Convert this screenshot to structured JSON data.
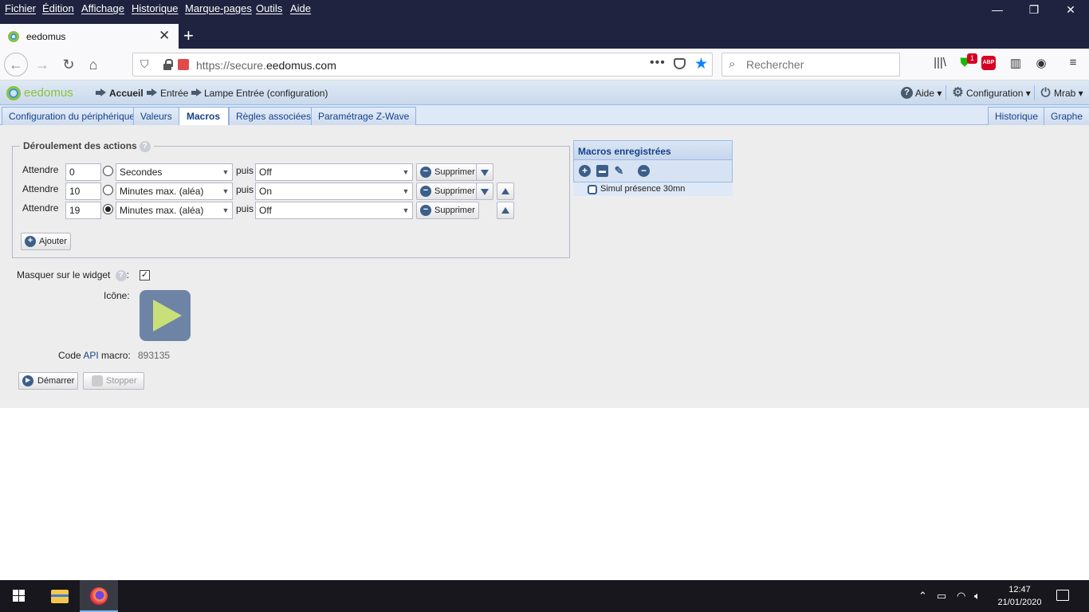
{
  "browser": {
    "menu": [
      "Fichier",
      "Édition",
      "Affichage",
      "Historique",
      "Marque-pages",
      "Outils",
      "Aide"
    ],
    "tab_title": "eedomus",
    "url_prefix": "https://secure.",
    "url_host": "eedomus.com",
    "search_placeholder": "Rechercher",
    "notification_badge": "1",
    "abp_label": "ABP",
    "window_controls": [
      "—",
      "❐",
      "✕"
    ]
  },
  "app": {
    "logo": "eedomus",
    "breadcrumb": [
      "Accueil",
      "Entrée",
      "Lampe Entrée (configuration)"
    ],
    "header_menus": {
      "help": "Aide",
      "config": "Configuration",
      "user": "Mrab"
    },
    "tabs": [
      "Configuration du périphérique",
      "Valeurs",
      "Macros",
      "Règles associées",
      "Paramétrage Z-Wave"
    ],
    "active_tab": "Macros",
    "right_tabs": [
      "Historique",
      "Graphe"
    ]
  },
  "actions": {
    "legend": "Déroulement des actions",
    "wait_label": "Attendre",
    "then_label": "puis",
    "delete_label": "Supprimer",
    "add_label": "Ajouter",
    "rows": [
      {
        "wait": "0",
        "unit": "Secondes",
        "value": "Off"
      },
      {
        "wait": "10",
        "unit": "Minutes max. (aléa)",
        "value": "On"
      },
      {
        "wait": "19",
        "unit": "Minutes max. (aléa)",
        "value": "Off"
      }
    ]
  },
  "widget": {
    "mask_label": "Masquer sur le widget",
    "mask_checked": true,
    "icon_label": "Icône:",
    "api_prefix": "Code ",
    "api_link": "API",
    "api_suffix": " macro:",
    "api_value": "893135",
    "start_label": "Démarrer",
    "stop_label": "Stopper"
  },
  "saved_macros": {
    "title": "Macros enregistrées",
    "items": [
      "Simul présence 30mn"
    ]
  },
  "taskbar": {
    "time": "12:47",
    "date": "21/01/2020"
  }
}
